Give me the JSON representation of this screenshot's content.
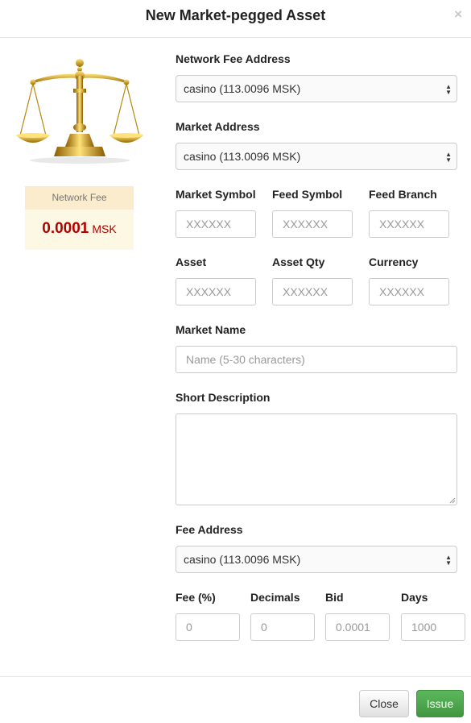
{
  "dialog": {
    "title": "New Market-pegged Asset",
    "close_glyph": "×"
  },
  "network_fee": {
    "title": "Network Fee",
    "amount": "0.0001",
    "unit": "MSK"
  },
  "form": {
    "network_fee_address": {
      "label": "Network Fee Address",
      "value": "casino (113.0096 MSK)"
    },
    "market_address": {
      "label": "Market Address",
      "value": "casino (113.0096 MSK)"
    },
    "market_symbol": {
      "label": "Market Symbol",
      "placeholder": "XXXXXX"
    },
    "feed_symbol": {
      "label": "Feed Symbol",
      "placeholder": "XXXXXX"
    },
    "feed_branch": {
      "label": "Feed Branch",
      "placeholder": "XXXXXX"
    },
    "asset": {
      "label": "Asset",
      "placeholder": "XXXXXX"
    },
    "asset_qty": {
      "label": "Asset Qty",
      "placeholder": "XXXXXX"
    },
    "currency": {
      "label": "Currency",
      "placeholder": "XXXXXX"
    },
    "market_name": {
      "label": "Market Name",
      "placeholder": "Name (5-30 characters)"
    },
    "short_description": {
      "label": "Short Description",
      "value": ""
    },
    "fee_address": {
      "label": "Fee Address",
      "value": "casino (113.0096 MSK)"
    },
    "fee_percent": {
      "label": "Fee (%)",
      "placeholder": "0"
    },
    "decimals": {
      "label": "Decimals",
      "placeholder": "0"
    },
    "bid": {
      "label": "Bid",
      "placeholder": "0.0001"
    },
    "days": {
      "label": "Days",
      "placeholder": "1000"
    }
  },
  "buttons": {
    "close": "Close",
    "issue": "Issue"
  },
  "colors": {
    "issue_green": "#4cae4c",
    "fee_red": "#b30000",
    "fee_box_bg": "#fcf8e3",
    "scale_gold": "#d4a017"
  },
  "icons": {
    "scale": "balance-scale-icon",
    "select_arrow": "updown-arrow-icon"
  }
}
